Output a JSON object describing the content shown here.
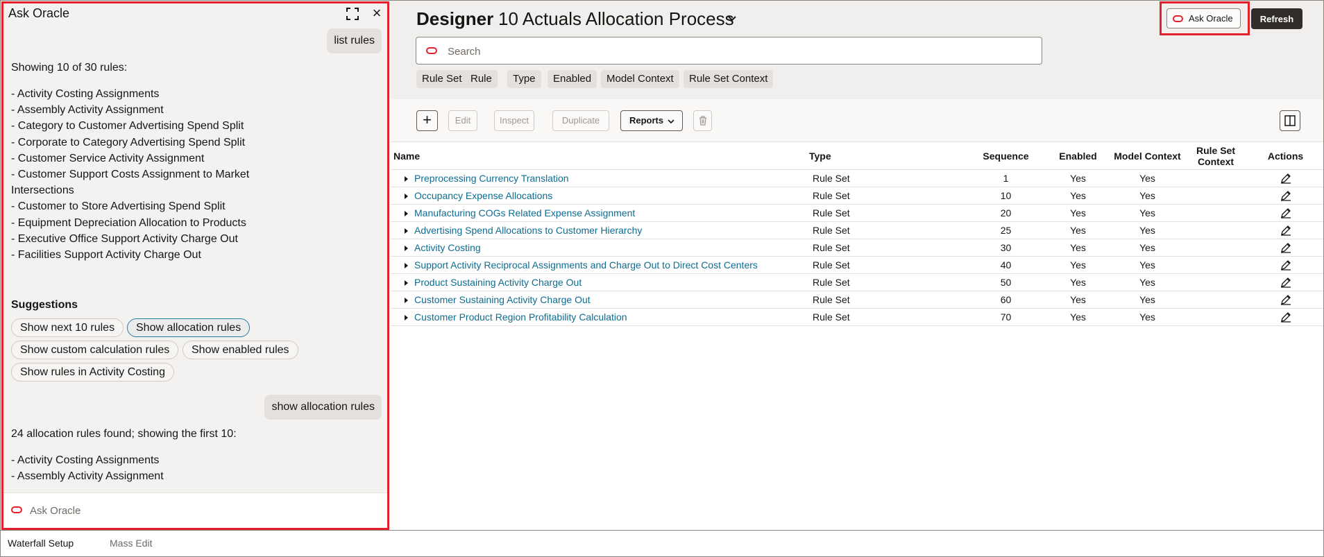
{
  "chat": {
    "title": "Ask Oracle",
    "messages": {
      "user_1": "list rules",
      "bot_1_intro": "Showing 10 of 30 rules:",
      "bot_1_rules": [
        "- Activity Costing Assignments",
        "- Assembly Activity Assignment",
        "- Category to Customer Advertising Spend Split",
        "- Corporate to Category Advertising Spend Split",
        "- Customer Service Activity Assignment",
        "- Customer Support Costs Assignment to Market Intersections",
        "- Customer to Store Advertising Spend Split",
        "- Equipment Depreciation Allocation to Products",
        "- Executive Office Support Activity Charge Out",
        "- Facilities Support Activity Charge Out"
      ],
      "suggestions_heading": "Suggestions",
      "suggestions": [
        "Show next 10 rules",
        "Show allocation rules",
        "Show custom calculation rules",
        "Show enabled rules",
        "Show rules in Activity Costing"
      ],
      "user_2": "show allocation rules",
      "bot_2_intro": "24 allocation rules found; showing the first 10:",
      "bot_2_rules": [
        "- Activity Costing Assignments",
        "- Assembly Activity Assignment"
      ]
    },
    "input_placeholder": "Ask Oracle"
  },
  "header": {
    "designer_label": "Designer",
    "process_title": "10 Actuals Allocation Process",
    "ask_oracle_label": "Ask Oracle",
    "refresh_label": "Refresh"
  },
  "search": {
    "placeholder": "Search"
  },
  "filters": [
    "Rule Set",
    "Rule",
    "Type",
    "Enabled",
    "Model Context",
    "Rule Set Context"
  ],
  "toolbar": {
    "add": "+",
    "edit": "Edit",
    "inspect": "Inspect",
    "duplicate": "Duplicate",
    "reports": "Reports"
  },
  "table": {
    "columns": {
      "name": "Name",
      "type": "Type",
      "sequence": "Sequence",
      "enabled": "Enabled",
      "model_context": "Model Context",
      "rule_set_context": "Rule Set Context",
      "actions": "Actions"
    },
    "rows": [
      {
        "name": "Preprocessing Currency Translation",
        "type": "Rule Set",
        "sequence": "1",
        "enabled": "Yes",
        "model_context": "Yes",
        "rule_set_context": ""
      },
      {
        "name": "Occupancy Expense Allocations",
        "type": "Rule Set",
        "sequence": "10",
        "enabled": "Yes",
        "model_context": "Yes",
        "rule_set_context": ""
      },
      {
        "name": "Manufacturing COGs Related Expense Assignment",
        "type": "Rule Set",
        "sequence": "20",
        "enabled": "Yes",
        "model_context": "Yes",
        "rule_set_context": ""
      },
      {
        "name": "Advertising Spend Allocations to Customer Hierarchy",
        "type": "Rule Set",
        "sequence": "25",
        "enabled": "Yes",
        "model_context": "Yes",
        "rule_set_context": ""
      },
      {
        "name": "Activity Costing",
        "type": "Rule Set",
        "sequence": "30",
        "enabled": "Yes",
        "model_context": "Yes",
        "rule_set_context": ""
      },
      {
        "name": "Support Activity Reciprocal Assignments and Charge Out to Direct Cost Centers",
        "type": "Rule Set",
        "sequence": "40",
        "enabled": "Yes",
        "model_context": "Yes",
        "rule_set_context": ""
      },
      {
        "name": "Product Sustaining Activity Charge Out",
        "type": "Rule Set",
        "sequence": "50",
        "enabled": "Yes",
        "model_context": "Yes",
        "rule_set_context": ""
      },
      {
        "name": "Customer Sustaining Activity Charge Out",
        "type": "Rule Set",
        "sequence": "60",
        "enabled": "Yes",
        "model_context": "Yes",
        "rule_set_context": ""
      },
      {
        "name": "Customer Product Region Profitability Calculation",
        "type": "Rule Set",
        "sequence": "70",
        "enabled": "Yes",
        "model_context": "Yes",
        "rule_set_context": ""
      }
    ]
  },
  "bottom_tabs": [
    "Waterfall Setup",
    "Mass Edit"
  ],
  "colors": {
    "highlight": "#e3202b",
    "link": "#0e6c90",
    "oracle_brand": "#e3202b",
    "refresh_bg": "#312d2a"
  },
  "icons": {
    "expand": "expand-icon",
    "close": "close-icon",
    "oracle": "oracle-logo-icon",
    "chevron": "chevron-down-icon",
    "add": "plus-icon",
    "delete": "trash-icon",
    "panel": "panel-toggle-icon",
    "row_expander": "expand-row-icon",
    "edit": "pencil-icon"
  }
}
